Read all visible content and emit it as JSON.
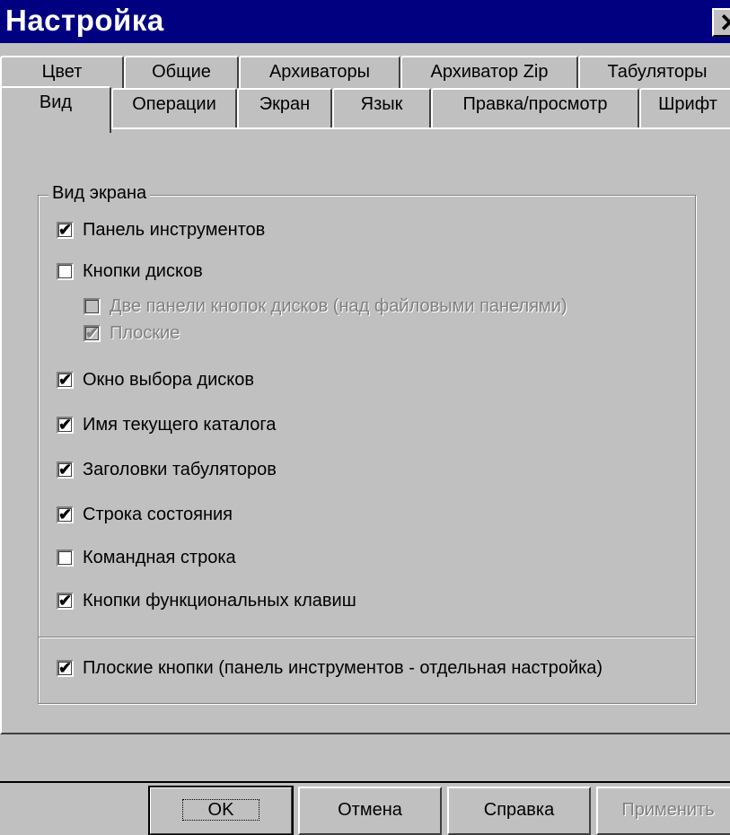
{
  "window": {
    "title": "Настройка",
    "close_label": "✕"
  },
  "tabs_row1": [
    "Цвет",
    "Общие",
    "Архиваторы",
    "Архиватор Zip",
    "Табуляторы"
  ],
  "tabs_row2": [
    "Вид",
    "Операции",
    "Экран",
    "Язык",
    "Правка/просмотр",
    "Шрифт"
  ],
  "active_tab": "Вид",
  "group": {
    "legend": "Вид экрана",
    "options": [
      {
        "label": "Панель инструментов",
        "checked": true,
        "disabled": false
      },
      {
        "label": "Кнопки дисков",
        "checked": false,
        "disabled": false
      },
      {
        "label": "Две панели кнопок дисков (над файловыми панелями)",
        "checked": false,
        "disabled": true
      },
      {
        "label": "Плоские",
        "checked": true,
        "disabled": true
      },
      {
        "label": "Окно выбора дисков",
        "checked": true,
        "disabled": false
      },
      {
        "label": "Имя текущего каталога",
        "checked": true,
        "disabled": false
      },
      {
        "label": "Заголовки табуляторов",
        "checked": true,
        "disabled": false
      },
      {
        "label": "Строка состояния",
        "checked": true,
        "disabled": false
      },
      {
        "label": "Командная строка",
        "checked": false,
        "disabled": false
      },
      {
        "label": "Кнопки функциональных клавиш",
        "checked": true,
        "disabled": false
      }
    ],
    "flat_buttons": {
      "label": "Плоские кнопки (панель инструментов - отдельная настройка)",
      "checked": true
    }
  },
  "buttons": {
    "ok": "OK",
    "cancel": "Отмена",
    "help": "Справка",
    "apply": "Применить"
  },
  "check_glyph": "✔"
}
